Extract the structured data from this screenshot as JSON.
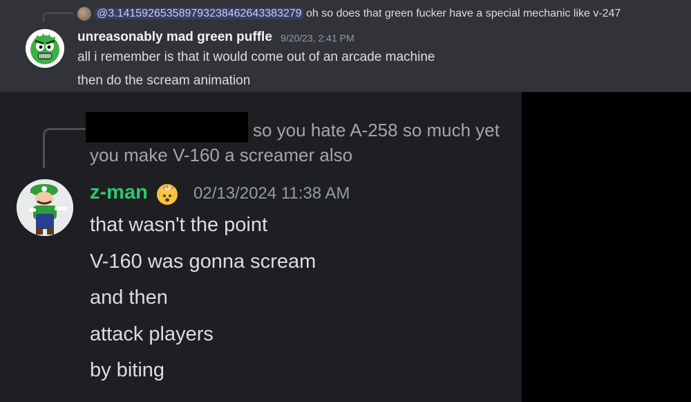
{
  "top_message": {
    "reply": {
      "mention": "@3.14159265358979323846264338327​9",
      "text": "oh so does that green fucker have a special mechanic like v-247"
    },
    "author": {
      "username": "unreasonably mad green puffle",
      "timestamp": "9/20/23, 2:41 PM"
    },
    "lines": [
      "all i remember is that it would come out of an arcade machine",
      "then do the scream animation"
    ]
  },
  "main_message": {
    "reply": {
      "text": "so you hate A-258 so much yet you make V-160 a screamer also"
    },
    "author": {
      "username": "z-man",
      "timestamp": "02/13/2024 11:38 AM"
    },
    "lines": [
      "that wasn't the point",
      "V-160 was gonna scream",
      "and then",
      "attack players",
      "by biting"
    ]
  },
  "colors": {
    "top_panel_bg": "#313338",
    "main_panel_bg": "#1e1f22",
    "username_main": "#2dc770",
    "mention": "#c9cdfb"
  }
}
